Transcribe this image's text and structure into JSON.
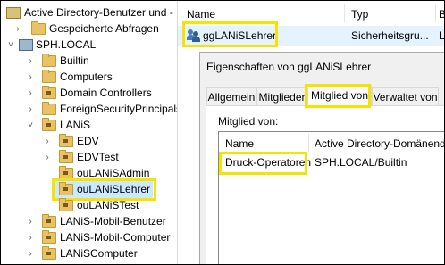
{
  "tree": {
    "root_label": "Active Directory-Benutzer und -",
    "items": [
      {
        "label": "Gespeicherte Abfragen"
      },
      {
        "label": "SPH.LOCAL"
      },
      {
        "label": "Builtin"
      },
      {
        "label": "Computers"
      },
      {
        "label": "Domain Controllers"
      },
      {
        "label": "ForeignSecurityPrincipals"
      },
      {
        "label": "LANiS"
      },
      {
        "label": "EDV"
      },
      {
        "label": "EDVTest"
      },
      {
        "label": "ouLANiSAdmin"
      },
      {
        "label": "ouLANiSLehrer"
      },
      {
        "label": "ouLANiSTest"
      },
      {
        "label": "LANiS-Mobil-Benutzer"
      },
      {
        "label": "LANiS-Mobil-Computer"
      },
      {
        "label": "LANiSComputer"
      }
    ]
  },
  "list": {
    "headers": {
      "name": "Name",
      "type": "Typ",
      "desc": "B"
    },
    "row": {
      "name": "ggLANiSLehrer",
      "type": "Sicherheitsgru...",
      "desc": "L"
    }
  },
  "dialog": {
    "title": "Eigenschaften von ggLANiSLehrer",
    "tabs": [
      "Allgemein",
      "Mitglieder",
      "Mitglied von",
      "Verwaltet von"
    ],
    "section_label": "Mitglied von:",
    "grid": {
      "headers": {
        "name": "Name",
        "folder": "Active Directory-Domänendiens"
      },
      "row": {
        "name": "Druck-Operatoren",
        "folder": "SPH.LOCAL/Builtin"
      }
    }
  },
  "colors": {
    "highlight": "#f5e400",
    "selection": "#cce8ff",
    "folder": "#e8c264"
  }
}
